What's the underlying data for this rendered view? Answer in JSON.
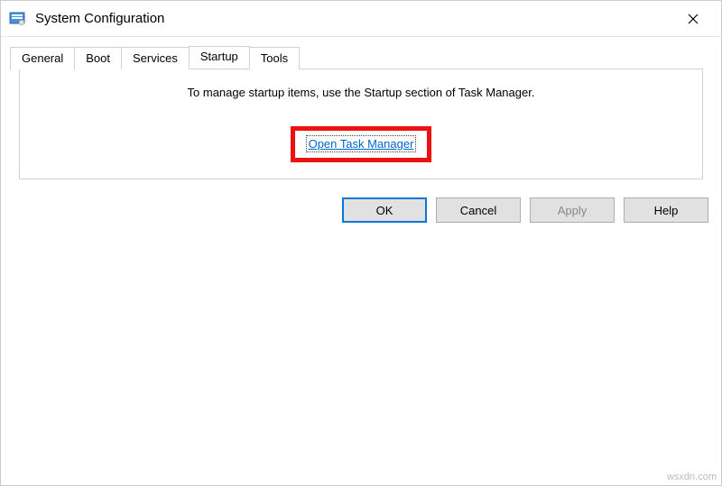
{
  "window": {
    "title": "System Configuration"
  },
  "tabs": {
    "general": "General",
    "boot": "Boot",
    "services": "Services",
    "startup": "Startup",
    "tools": "Tools"
  },
  "content": {
    "instruction": "To manage startup items, use the Startup section of Task Manager.",
    "link": "Open Task Manager"
  },
  "buttons": {
    "ok": "OK",
    "cancel": "Cancel",
    "apply": "Apply",
    "help": "Help"
  },
  "watermark": "wsxdn.com"
}
